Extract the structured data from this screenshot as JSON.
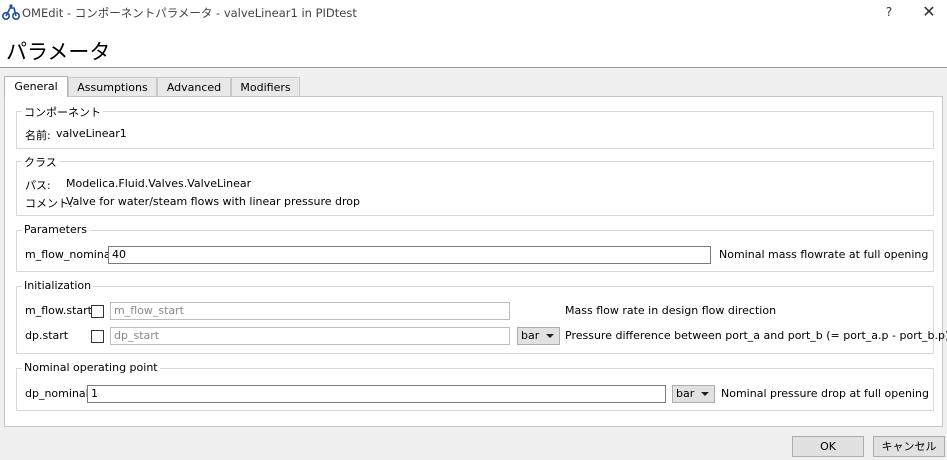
{
  "window": {
    "title": "OMEdit - コンポーネントパラメータ - valveLinear1 in PIDtest",
    "help": "?",
    "close": "✕"
  },
  "page_title": "パラメータ",
  "tabs": [
    {
      "label": "General",
      "active": true
    },
    {
      "label": "Assumptions",
      "active": false
    },
    {
      "label": "Advanced",
      "active": false
    },
    {
      "label": "Modifiers",
      "active": false
    }
  ],
  "component": {
    "legend": "コンポーネント",
    "name_label": "名前:",
    "name_value": "valveLinear1"
  },
  "class_group": {
    "legend": "クラス",
    "path_label": "パス:",
    "path_value": "Modelica.Fluid.Valves.ValveLinear",
    "comment_label": "コメント:",
    "comment_value": "Valve for water/steam flows with linear pressure drop"
  },
  "parameters": {
    "legend": "Parameters",
    "m_flow_nominal": {
      "label": "m_flow_nominal",
      "value": "40",
      "description": "Nominal mass flowrate at full opening"
    }
  },
  "initialization": {
    "legend": "Initialization",
    "m_flow_start": {
      "label": "m_flow.start",
      "checked": false,
      "placeholder": "m_flow_start",
      "description": "Mass flow rate in design flow direction"
    },
    "dp_start": {
      "label": "dp.start",
      "checked": false,
      "placeholder": "dp_start",
      "unit": "bar",
      "description": "Pressure difference between port_a and port_b (= port_a.p - port_b.p)"
    }
  },
  "nominal_op": {
    "legend": "Nominal operating point",
    "dp_nominal": {
      "label": "dp_nominal",
      "value": "1",
      "unit": "bar",
      "description": "Nominal pressure drop at full opening"
    }
  },
  "buttons": {
    "ok": "OK",
    "cancel": "キャンセル"
  }
}
